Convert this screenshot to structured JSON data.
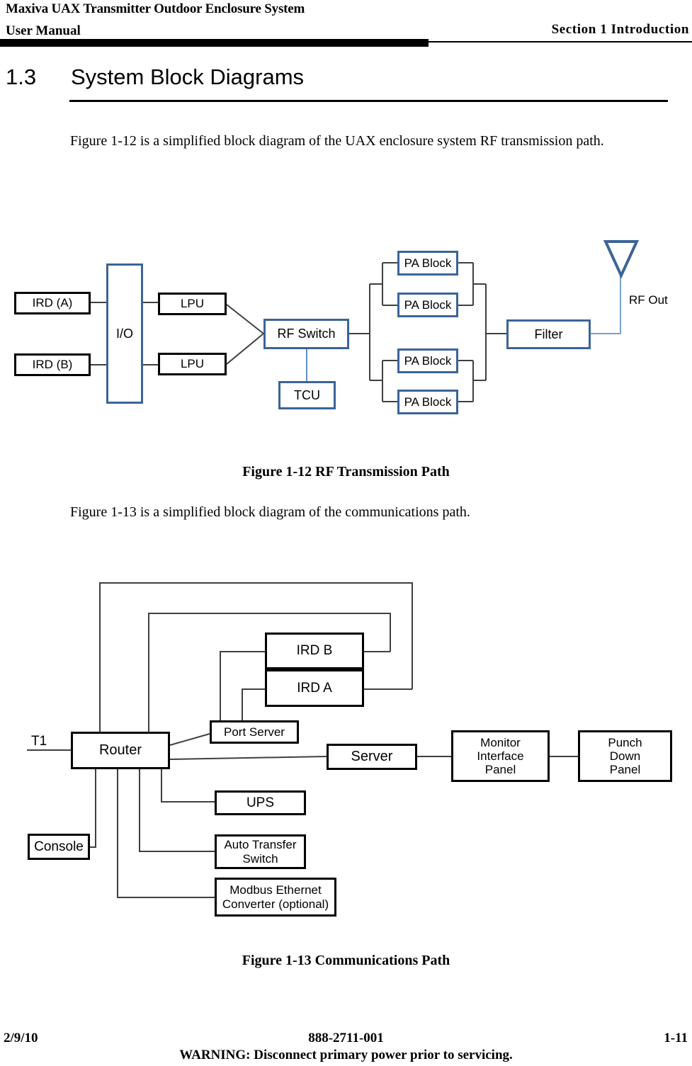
{
  "header": {
    "title": "Maxiva UAX Transmitter Outdoor Enclosure System",
    "subtitle": "User Manual",
    "section": "Section 1 Introduction"
  },
  "section": {
    "number": "1.3",
    "title": "System Block Diagrams"
  },
  "body": {
    "paragraph_1": "Figure 1-12 is a simplified block diagram of the UAX enclosure system RF transmission path.",
    "paragraph_2": "Figure 1-13 is a simplified block diagram of the communications path."
  },
  "figures": {
    "figure_1_12_caption": "Figure 1-12  RF Transmission Path",
    "figure_1_13_caption": "Figure 1-13  Communications Path"
  },
  "colors": {
    "blue_border": "#3b6497",
    "black_border": "#000000",
    "connector_black": "#3f3f3f",
    "connector_blue": "#7aa1cc"
  },
  "diagram_rf": {
    "nodes": {
      "ird_a": "IRD (A)",
      "ird_b": "IRD (B)",
      "io": "I/O",
      "lpu_top": "LPU",
      "lpu_bottom": "LPU",
      "rf_switch": "RF Switch",
      "tcu": "TCU",
      "pa_block_1": "PA Block",
      "pa_block_2": "PA Block",
      "pa_block_3": "PA Block",
      "pa_block_4": "PA Block",
      "filter": "Filter",
      "rf_out_label": "RF Out",
      "antenna_icon": "antenna-triangle-icon"
    }
  },
  "diagram_comms": {
    "nodes": {
      "t1": "T1",
      "router": "Router",
      "console": "Console",
      "port_server": "Port Server",
      "ird_b": "IRD B",
      "ird_a": "IRD A",
      "ups": "UPS",
      "auto_transfer_switch": "Auto Transfer\nSwitch",
      "auto_transfer_switch_line1": "Auto Transfer",
      "auto_transfer_switch_line2": "Switch",
      "modbus_line1": "Modbus Ethernet",
      "modbus_line2": "Converter (optional)",
      "server": "Server",
      "monitor_interface_panel_line1": "Monitor",
      "monitor_interface_panel_line2": "Interface",
      "monitor_interface_panel_line3": "Panel",
      "punch_down_panel_line1": "Punch",
      "punch_down_panel_line2": "Down",
      "punch_down_panel_line3": "Panel"
    }
  },
  "footer": {
    "date": "2/9/10",
    "part_number": "888-2711-001",
    "page": "1-11",
    "warning": "WARNING: Disconnect primary power prior to servicing."
  }
}
